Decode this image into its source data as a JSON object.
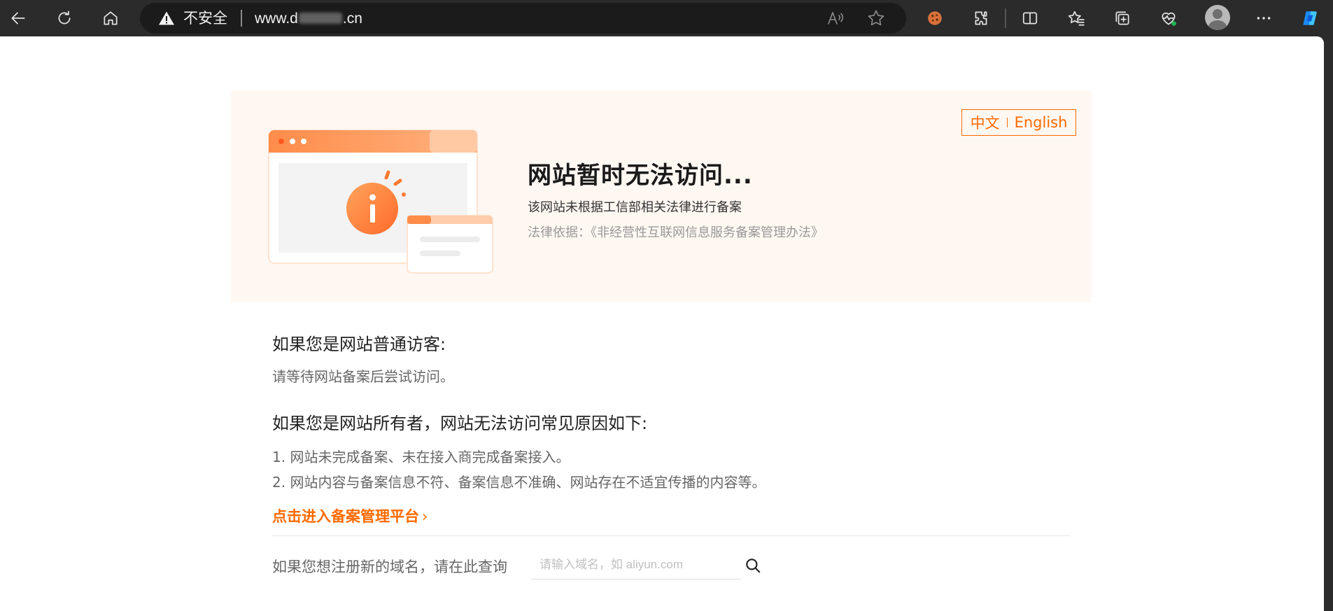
{
  "browser": {
    "security_text": "不安全",
    "url_prefix": "www.d",
    "url_suffix": ".cn",
    "icons": [
      "back-icon",
      "refresh-icon",
      "home-icon",
      "warning-icon",
      "read-aloud-icon",
      "favorite-star-icon",
      "cookie-icon",
      "extensions-icon",
      "split-screen-icon",
      "favorites-icon",
      "collections-icon",
      "browser-essentials-icon",
      "profile-icon",
      "more-icon",
      "copilot-icon"
    ]
  },
  "hero": {
    "lang_zh": "中文",
    "lang_en": "English",
    "title": "网站暂时无法访问...",
    "desc": "该网站未根据工信部相关法律进行备案",
    "law": "法律依据：《非经营性互联网信息服务备案管理办法》",
    "accent_color": "#ff6a00"
  },
  "visitor": {
    "heading": "如果您是网站普通访客:",
    "text": "请等待网站备案后尝试访问。"
  },
  "owner": {
    "heading": "如果您是网站所有者，网站无法访问常见原因如下:",
    "reasons": [
      "1. 网站未完成备案、未在接入商完成备案接入。",
      "2. 网站内容与备案信息不符、备案信息不准确、网站存在不适宜传播的内容等。"
    ],
    "link_text": "点击进入备案管理平台",
    "link_chevron": "›"
  },
  "domain_search": {
    "label": "如果您想注册新的域名，请在此查询",
    "placeholder": "请输入域名，如 aliyun.com",
    "value": ""
  }
}
